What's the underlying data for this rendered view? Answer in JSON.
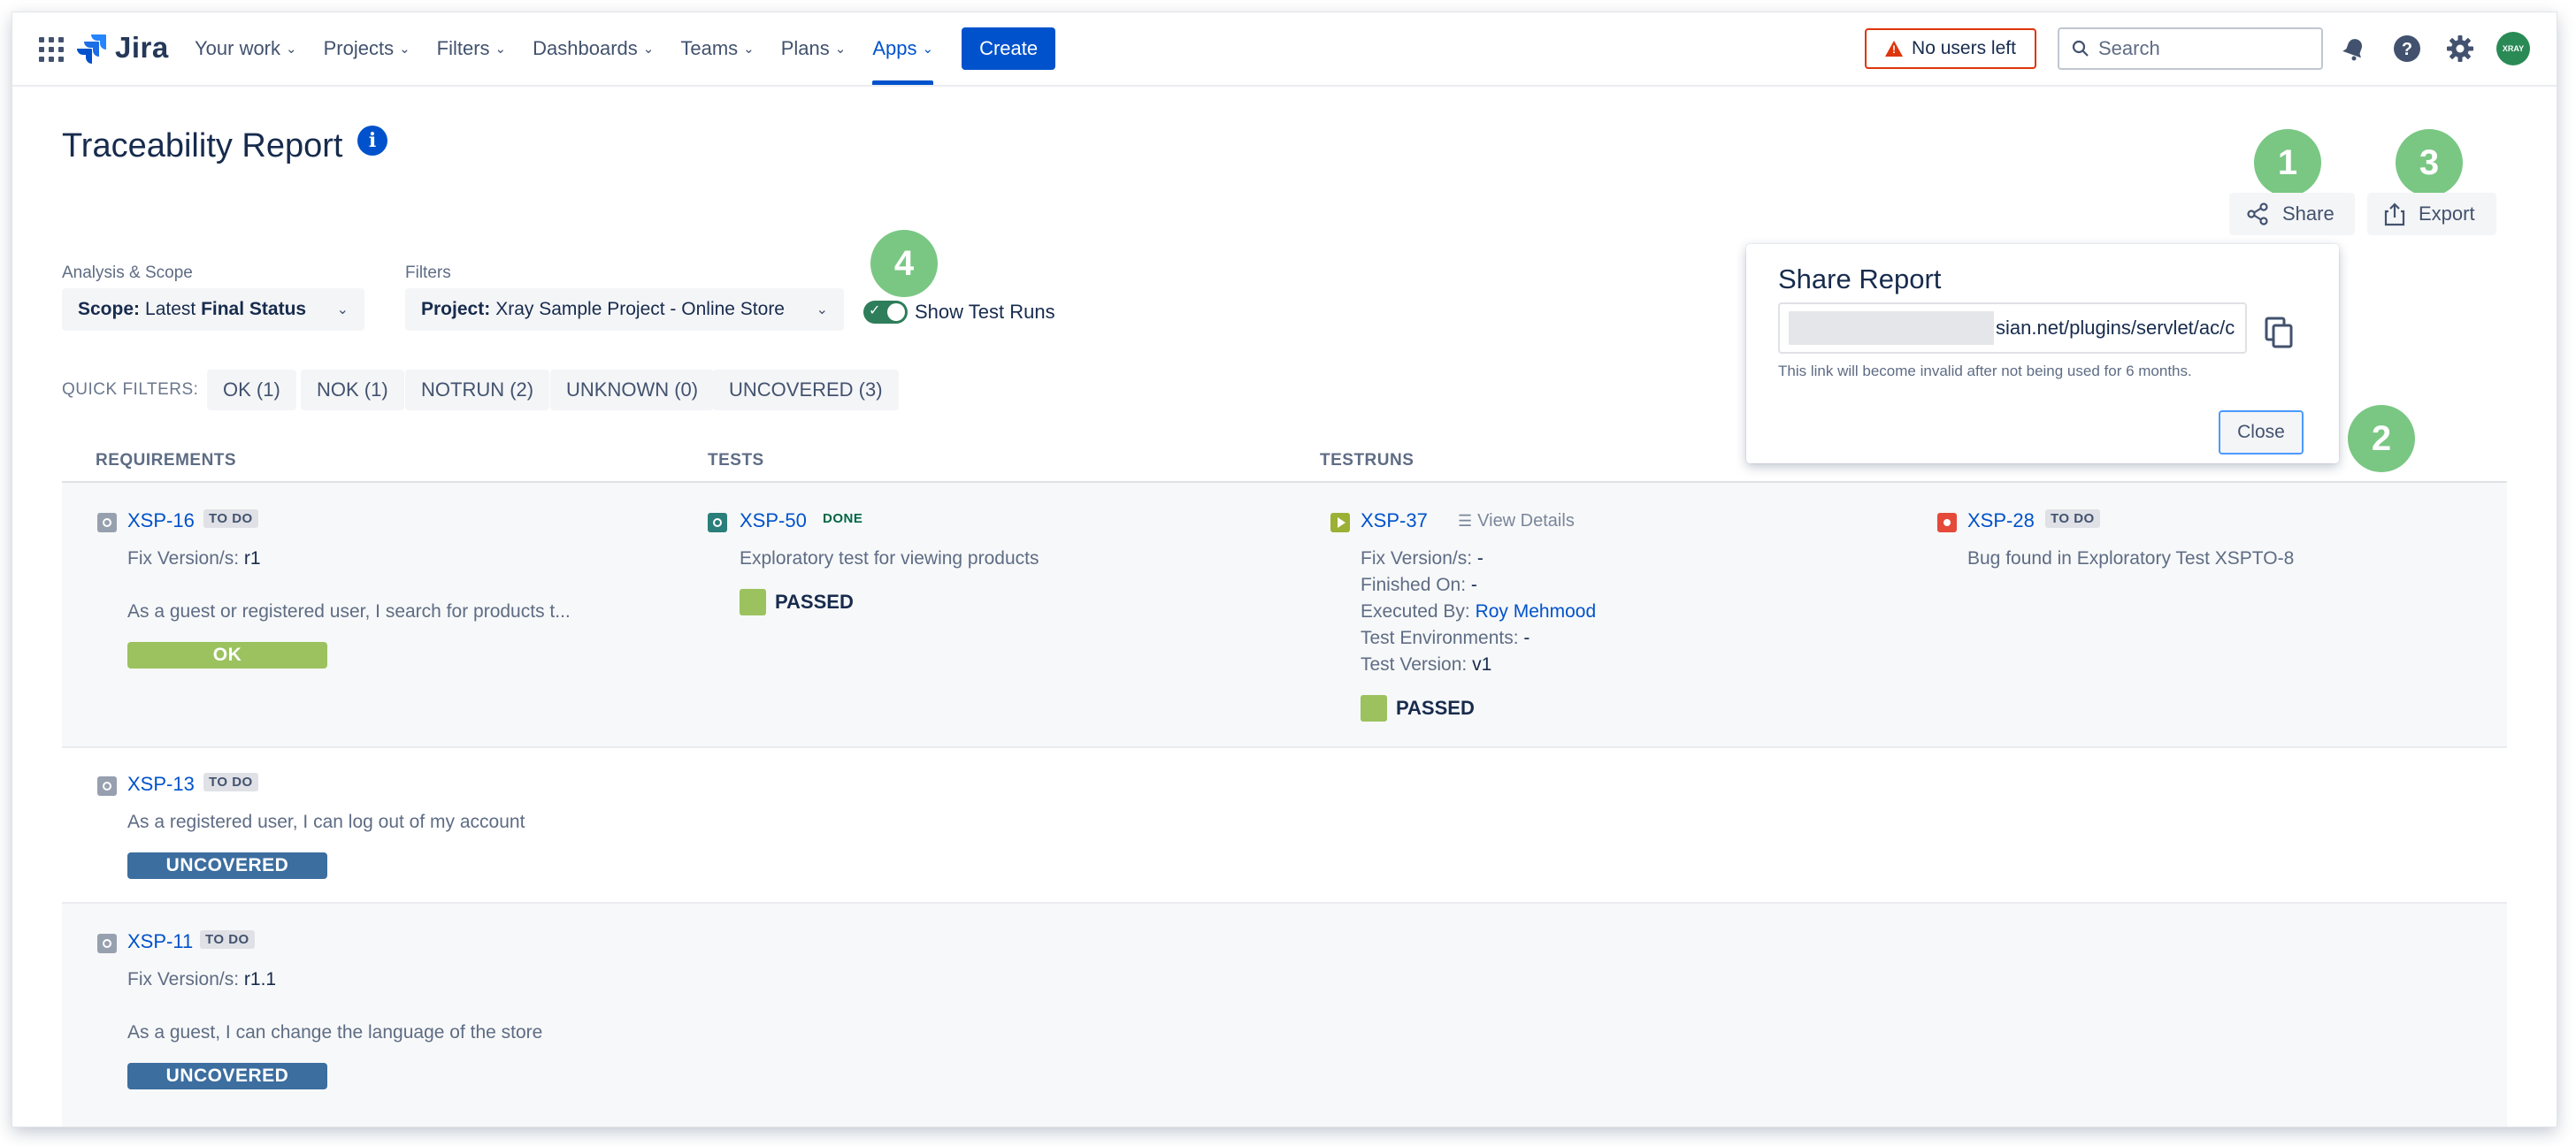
{
  "nav": {
    "app_name": "Jira",
    "items": [
      {
        "label": "Your work"
      },
      {
        "label": "Projects"
      },
      {
        "label": "Filters"
      },
      {
        "label": "Dashboards"
      },
      {
        "label": "Teams"
      },
      {
        "label": "Plans"
      },
      {
        "label": "Apps"
      }
    ],
    "create_label": "Create",
    "alert_label": "No users left",
    "search_placeholder": "Search",
    "avatar_initials": "XRAY"
  },
  "page": {
    "title": "Traceability Report",
    "share_label": "Share",
    "export_label": "Export"
  },
  "callouts": [
    "1",
    "2",
    "3",
    "4"
  ],
  "filters": {
    "analysis_label": "Analysis & Scope",
    "scope_key": "Scope:",
    "scope_value1": "Latest ",
    "scope_value2": "Final Status",
    "filters_label": "Filters",
    "project_key": "Project:",
    "project_value": "Xray Sample Project - Online Store",
    "show_runs_label": "Show Test Runs",
    "quick_filters_label": "QUICK FILTERS:",
    "quick_filters": [
      "OK (1)",
      "NOK (1)",
      "NOTRUN (2)",
      "UNKNOWN (0)",
      "UNCOVERED (3)"
    ]
  },
  "table": {
    "headers": [
      "REQUIREMENTS",
      "TESTS",
      "TESTRUNS"
    ],
    "rows": [
      {
        "req_key": "XSP-16",
        "req_status": "TO DO",
        "req_fix_label": "Fix Version/s:",
        "req_fix_value": "r1",
        "req_summary": "As a guest or registered user, I search for products t...",
        "req_coverage": "OK",
        "test_key": "XSP-50",
        "test_status": "DONE",
        "test_summary": "Exploratory test for viewing products",
        "test_result": "PASSED",
        "run_key": "XSP-37",
        "run_view": "View Details",
        "run_fix_label": "Fix Version/s:",
        "run_fix_value": "-",
        "run_finished_label": "Finished On:",
        "run_finished_value": "-",
        "run_exec_label": "Executed By:",
        "run_exec_value": "Roy Mehmood",
        "run_env_label": "Test Environments:",
        "run_env_value": "-",
        "run_ver_label": "Test Version:",
        "run_ver_value": "v1",
        "run_result": "PASSED",
        "defect_key": "XSP-28",
        "defect_status": "TO DO",
        "defect_summary": "Bug found in Exploratory Test XSPTO-8"
      },
      {
        "req_key": "XSP-13",
        "req_status": "TO DO",
        "req_summary": "As a registered user, I can log out of my account",
        "req_coverage": "UNCOVERED"
      },
      {
        "req_key": "XSP-11",
        "req_status": "TO DO",
        "req_fix_label": "Fix Version/s:",
        "req_fix_value": "r1.1",
        "req_summary": "As a guest, I can change the language of the store",
        "req_coverage": "UNCOVERED"
      }
    ]
  },
  "share_popup": {
    "title": "Share Report",
    "url_visible": "sian.net/plugins/servlet/ac/c",
    "note": "This link will become invalid after not being used for 6 months.",
    "close_label": "Close"
  },
  "colors": {
    "brand_blue": "#0052cc",
    "callout_green": "#79c783",
    "ok_green": "#9bc25f",
    "uncovered_blue": "#3c6e9f",
    "alert_red": "#de350b"
  }
}
